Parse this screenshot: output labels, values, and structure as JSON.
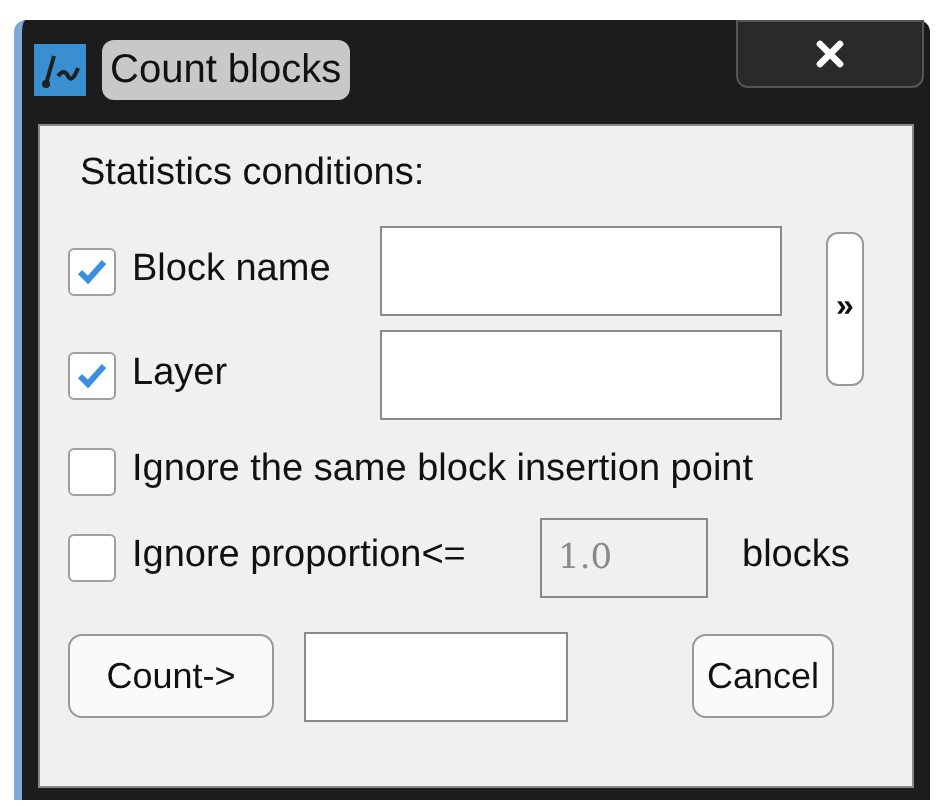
{
  "window": {
    "title": "Count blocks"
  },
  "group_label": "Statistics conditions:",
  "conditions": [
    {
      "kind": "field",
      "label": "Block name",
      "checked": true
    },
    {
      "kind": "field",
      "label": "Layer",
      "checked": true
    },
    {
      "kind": "plain",
      "label": "Ignore the same block insertion point",
      "checked": false
    },
    {
      "kind": "proportion",
      "label": "Ignore proportion<=",
      "checked": false,
      "value": "1.0",
      "disabled": true,
      "unit": "blocks"
    }
  ],
  "expand_button": "»",
  "count_button": "Count->",
  "cancel_button": "Cancel"
}
